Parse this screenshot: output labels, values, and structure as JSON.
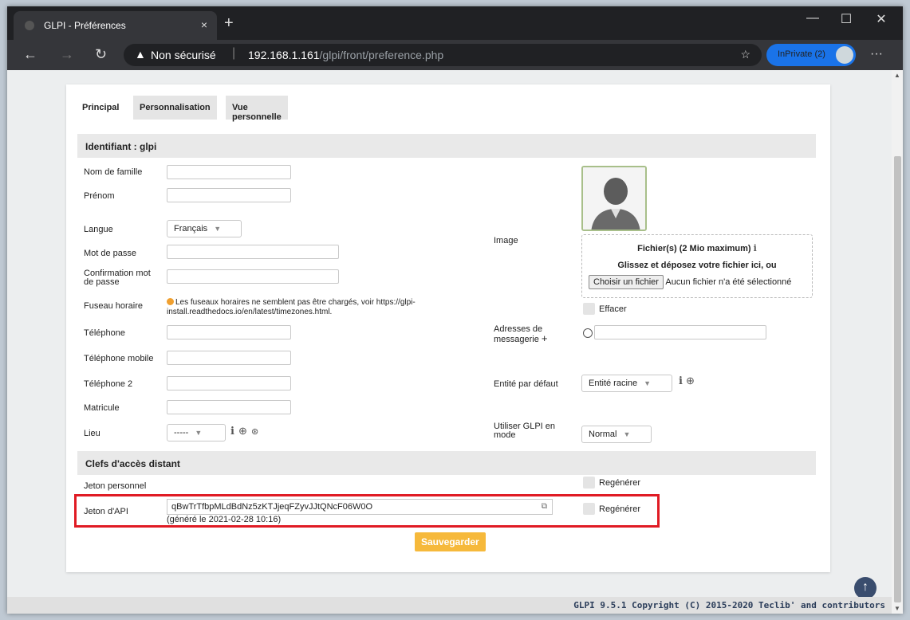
{
  "browser": {
    "tab_title": "GLPI - Préférences",
    "tab_close": "×",
    "new_tab": "+",
    "security_label": "Non sécurisé",
    "url_host": "192.168.1.161",
    "url_path": "/glpi/front/preference.php",
    "inprivate_label": "InPrivate (2)",
    "menu": "···",
    "minimize": "—",
    "maximize": "☐",
    "close": "✕"
  },
  "tabs": [
    "Principal",
    "Personnalisation",
    "Vue personnelle"
  ],
  "section_identity": "Identifiant : glpi",
  "section_keys": "Clefs d'accès distant",
  "fields": {
    "nom": "Nom de famille",
    "prenom": "Prénom",
    "langue": "Langue",
    "langue_value": "Français",
    "mdp": "Mot de passe",
    "confirmation": "Confirmation mot de passe",
    "fuseau": "Fuseau horaire",
    "fuseau_warning": "Les fuseaux horaires ne semblent pas être chargés, voir https://glpi-install.readthedocs.io/en/latest/timezones.html.",
    "telephone": "Téléphone",
    "telephone_mobile": "Téléphone mobile",
    "telephone2": "Téléphone 2",
    "matricule": "Matricule",
    "lieu": "Lieu",
    "lieu_value": "-----",
    "image": "Image",
    "adresses": "Adresses de messagerie",
    "entite": "Entité par défaut",
    "entite_value": "Entité racine",
    "utiliser": "Utiliser GLPI en mode",
    "mode_value": "Normal",
    "jeton_perso": "Jeton personnel",
    "jeton_api": "Jeton d'API",
    "jeton_api_value": "qBwTrTfbpMLdBdNz5zKTJjeqFZyvJJtQNcF06W0O",
    "jeton_api_generated": "(généré le 2021-02-28 10:16)"
  },
  "upload": {
    "title": "Fichier(s) (2 Mio maximum)",
    "drop_text": "Glissez et déposez votre fichier ici, ou",
    "choose_button": "Choisir un fichier",
    "no_file": "Aucun fichier n'a été sélectionné",
    "effacer": "Effacer"
  },
  "regenerer": "Regénérer",
  "save_button": "Sauvegarder",
  "footer": "GLPI 9.5.1 Copyright (C) 2015-2020 Teclib' and contributors",
  "colors": {
    "accent": "#f6b93b",
    "highlight": "#e01b24",
    "inprivate": "#1a73e8"
  }
}
